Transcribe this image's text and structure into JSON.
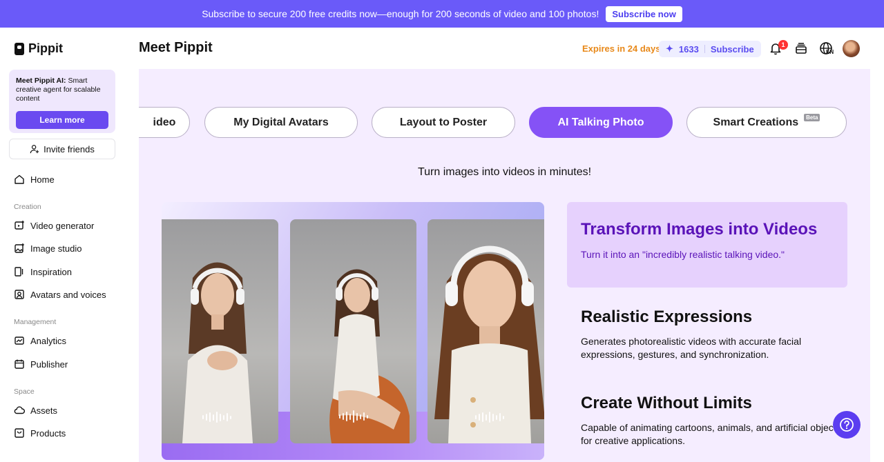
{
  "banner": {
    "text": "Subscribe to secure 200 free credits now—enough for 200 seconds of video and 100 photos!",
    "button": "Subscribe now"
  },
  "brand": {
    "name": "Pippit"
  },
  "sidebar": {
    "promo": {
      "title": "Meet Pippit AI:",
      "text": " Smart creative agent for scalable content",
      "button": "Learn more"
    },
    "invite": "Invite friends",
    "home": "Home",
    "sections": {
      "creation": "Creation",
      "management": "Management",
      "space": "Space"
    },
    "items": {
      "video_generator": "Video generator",
      "image_studio": "Image studio",
      "inspiration": "Inspiration",
      "avatars_voices": "Avatars and voices",
      "analytics": "Analytics",
      "publisher": "Publisher",
      "assets": "Assets",
      "products": "Products"
    }
  },
  "header": {
    "title": "Meet Pippit",
    "expires": "Expires in 24 days",
    "credits": "1633",
    "subscribe": "Subscribe",
    "notification_count": "1",
    "language": "EN"
  },
  "tabs": [
    {
      "label": "ideo"
    },
    {
      "label": "My Digital Avatars"
    },
    {
      "label": "Layout to Poster"
    },
    {
      "label": "AI Talking Photo",
      "active": true
    },
    {
      "label": "Smart Creations",
      "badge": "Beta"
    }
  ],
  "tagline": "Turn images into videos in minutes!",
  "features": [
    {
      "title": "Transform Images into Videos",
      "desc": "Turn it into an \"incredibly realistic talking video.\""
    },
    {
      "title": "Realistic Expressions",
      "desc": "Generates photorealistic videos with accurate facial expressions, gestures, and synchronization."
    },
    {
      "title": "Create Without Limits",
      "desc": "Capable of animating cartoons, animals, and artificial objects for creative applications."
    }
  ],
  "colors": {
    "accent": "#6a5af9",
    "active_tab": "#8552f6",
    "expires": "#e8891a",
    "panel_bg": "#f5edff"
  }
}
